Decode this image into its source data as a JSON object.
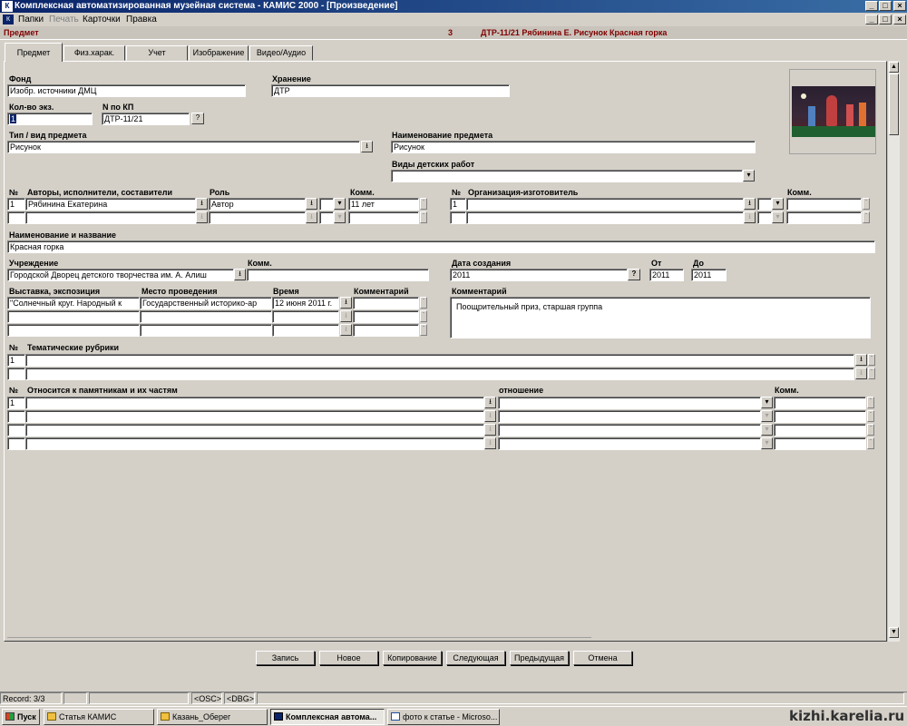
{
  "window": {
    "title": "Комплексная автоматизированная музейная система - КАМИС 2000 - [Произведение]"
  },
  "menu": [
    "Папки",
    "Печать",
    "Карточки",
    "Правка"
  ],
  "info": {
    "section": "Предмет",
    "count": "3",
    "record_title": "ДТР-11/21 Рябинина Е. Рисунок Красная горка"
  },
  "tabs": [
    "Предмет",
    "Физ.харак.",
    "Учет",
    "Изображение",
    "Видео/Аудио"
  ],
  "labels": {
    "fond": "Фонд",
    "storage": "Хранение",
    "qty": "Кол-во экз.",
    "kp": "N  по КП",
    "type": "Тип / вид предмета",
    "name": "Наименование предмета",
    "kids_works": "Виды детских работ",
    "num": "№",
    "authors": "Авторы, исполнители, составители",
    "role": "Роль",
    "comm": "Комм.",
    "org": "Организация-изготовитель",
    "title": "Наименование и название",
    "institution": "Учреждение",
    "creation_date": "Дата создания",
    "from": "От",
    "to": "До",
    "exhibition": "Выставка, экспозиция",
    "venue": "Место проведения",
    "time": "Время",
    "commentary": "Комментарий",
    "rubrics": "Тематические рубрики",
    "monuments": "Относится к памятникам и их частям",
    "relation": "отношение"
  },
  "fields": {
    "fond": "Изобр. источники ДМЦ",
    "storage": "ДТР",
    "qty": "1",
    "kp": "ДТР-11/21",
    "type": "Рисунок",
    "name": "Рисунок",
    "kids_works": "",
    "author_num": "1",
    "author": "Рябинина Екатерина",
    "role": "Автор",
    "author_comm": "11 лет",
    "org_num": "1",
    "title": "Красная горка",
    "institution": "Городской Дворец детского творчества им. А. Алиш",
    "creation_date": "2011",
    "date_from": "2011",
    "date_to": "2011",
    "exhibition": "\"Солнечный круг. Народный к",
    "venue": "Государственный историко-ар",
    "time": "12 июня 2011 г.",
    "commentary": "Поощрительный приз, старшая группа",
    "rubric_num": "1",
    "monument_num": "1"
  },
  "buttons": [
    "Запись",
    "Новое",
    "Копирование",
    "Следующая",
    "Предыдущая",
    "Отмена"
  ],
  "status": {
    "record": "Record: 3/3",
    "osc": "<OSC>",
    "dbg": "<DBG>"
  },
  "taskbar": {
    "start": "Пуск",
    "tasks": [
      "Статья КАМИС",
      "Казань_Оберег",
      "Комплексная автома...",
      "фото к статье - Microso..."
    ],
    "watermark": "kizhi.karelia.ru"
  },
  "icons": {
    "dropdown": "dropdown-arrow-icon",
    "help": "question-icon",
    "app": "kamis-app-icon"
  }
}
